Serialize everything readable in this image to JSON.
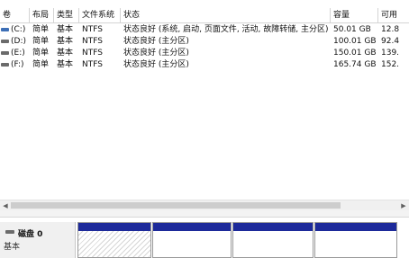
{
  "columns": {
    "volume": "卷",
    "layout": "布局",
    "type": "类型",
    "filesystem": "文件系统",
    "status": "状态",
    "capacity": "容量",
    "free": "可用"
  },
  "volumes": [
    {
      "name": "(C:)",
      "layout": "简单",
      "type": "基本",
      "filesystem": "NTFS",
      "status": "状态良好 (系统, 启动, 页面文件, 活动, 故障转储, 主分区)",
      "capacity": "50.01 GB",
      "free": "12.8"
    },
    {
      "name": "(D:)",
      "layout": "简单",
      "type": "基本",
      "filesystem": "NTFS",
      "status": "状态良好 (主分区)",
      "capacity": "100.01 GB",
      "free": "92.4"
    },
    {
      "name": "(E:)",
      "layout": "简单",
      "type": "基本",
      "filesystem": "NTFS",
      "status": "状态良好 (主分区)",
      "capacity": "150.01 GB",
      "free": "139."
    },
    {
      "name": "(F:)",
      "layout": "简单",
      "type": "基本",
      "filesystem": "NTFS",
      "status": "状态良好 (主分区)",
      "capacity": "165.74 GB",
      "free": "152."
    }
  ],
  "disk_graph": {
    "disk_title": "磁盘 0",
    "disk_type": "基本",
    "partition_color": "#1d2a9a"
  },
  "icons": {
    "drive": "drive-icon",
    "disk": "disk-icon",
    "scroll_left": "◀",
    "scroll_right": "▶"
  }
}
